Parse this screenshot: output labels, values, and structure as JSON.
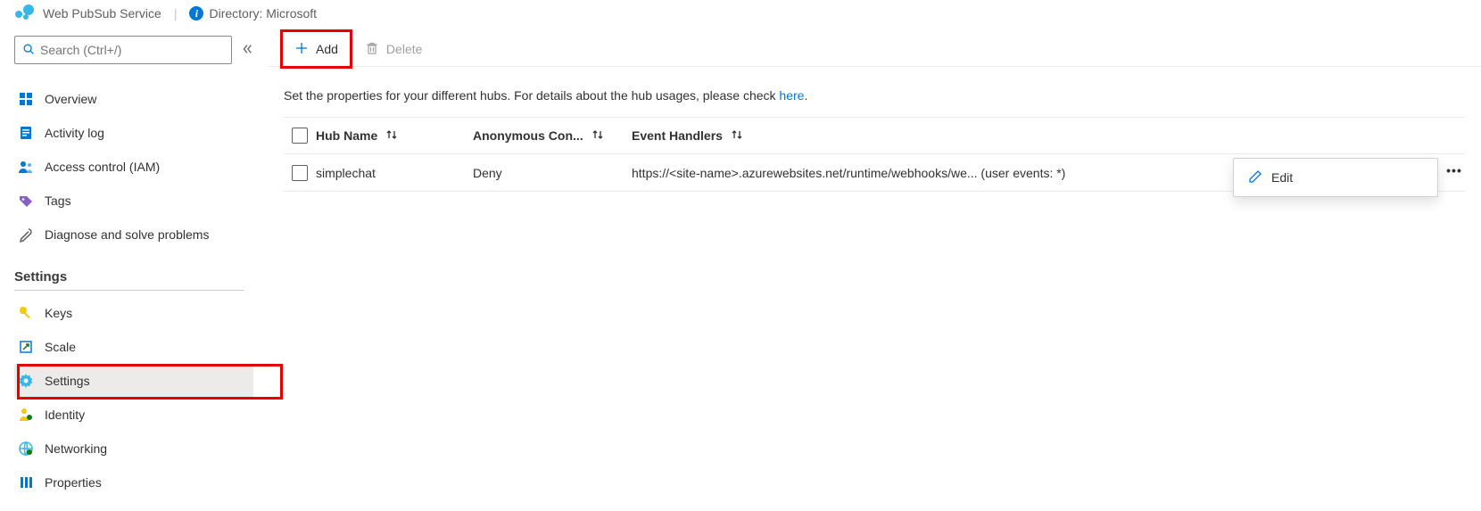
{
  "topbar": {
    "service_name": "Web PubSub Service",
    "directory_label": "Directory: Microsoft"
  },
  "search": {
    "placeholder": "Search (Ctrl+/)"
  },
  "nav": {
    "primary": [
      {
        "id": "overview",
        "label": "Overview"
      },
      {
        "id": "activity-log",
        "label": "Activity log"
      },
      {
        "id": "access-control",
        "label": "Access control (IAM)"
      },
      {
        "id": "tags",
        "label": "Tags"
      },
      {
        "id": "diagnose",
        "label": "Diagnose and solve problems"
      }
    ],
    "settings_heading": "Settings",
    "settings": [
      {
        "id": "keys",
        "label": "Keys"
      },
      {
        "id": "scale",
        "label": "Scale"
      },
      {
        "id": "settings",
        "label": "Settings",
        "selected": true
      },
      {
        "id": "identity",
        "label": "Identity"
      },
      {
        "id": "networking",
        "label": "Networking"
      },
      {
        "id": "properties",
        "label": "Properties"
      }
    ]
  },
  "toolbar": {
    "add_label": "Add",
    "delete_label": "Delete"
  },
  "description": {
    "text": "Set the properties for your different hubs. For details about the hub usages, please check ",
    "link_text": "here",
    "period": "."
  },
  "table": {
    "columns": {
      "hub_name": "Hub Name",
      "anonymous": "Anonymous Con...",
      "event_handlers": "Event Handlers"
    },
    "rows": [
      {
        "hub_name": "simplechat",
        "anonymous": "Deny",
        "event_handlers": "https://<site-name>.azurewebsites.net/runtime/webhooks/we... (user events: *)"
      }
    ]
  },
  "context_menu": {
    "edit_label": "Edit"
  }
}
